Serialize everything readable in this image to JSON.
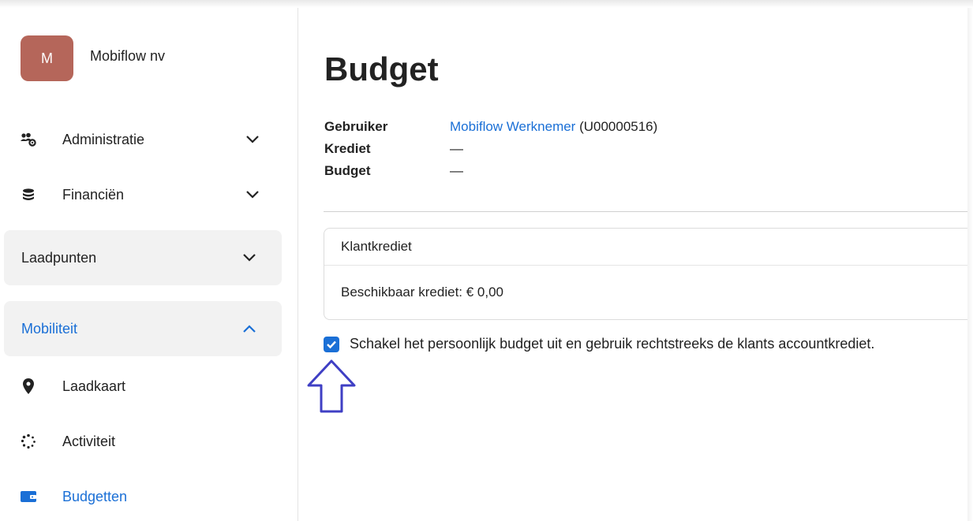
{
  "org": {
    "avatar_letter": "M",
    "avatar_color": "#b5665a",
    "name": "Mobiflow nv"
  },
  "sidebar": {
    "items": [
      {
        "label": "Administratie",
        "icon": "users-gear-icon",
        "expanded": false
      },
      {
        "label": "Financiën",
        "icon": "coins-icon",
        "expanded": false
      }
    ],
    "groups": [
      {
        "label": "Laadpunten",
        "expanded": false
      },
      {
        "label": "Mobiliteit",
        "expanded": true
      }
    ],
    "sub_items": [
      {
        "label": "Laadkaart",
        "icon": "map-pin-icon"
      },
      {
        "label": "Activiteit",
        "icon": "spinner-icon"
      },
      {
        "label": "Budgetten",
        "icon": "wallet-icon",
        "active": true
      }
    ]
  },
  "main": {
    "title": "Budget",
    "meta": {
      "user_key": "Gebruiker",
      "user_link": "Mobiflow Werknemer",
      "user_id": " (U00000516)",
      "credit_key": "Krediet",
      "credit_val": "—",
      "budget_key": "Budget",
      "budget_val": "—"
    },
    "card": {
      "header": "Klantkrediet",
      "body": "Beschikbaar krediet: € 0,00"
    },
    "checkbox": {
      "checked": true,
      "label": "Schakel het persoonlijk budget uit en gebruik rechtstreeks de klants accountkrediet."
    }
  },
  "colors": {
    "accent": "#1a6fd6",
    "annotation_arrow": "#3f3fc4"
  }
}
